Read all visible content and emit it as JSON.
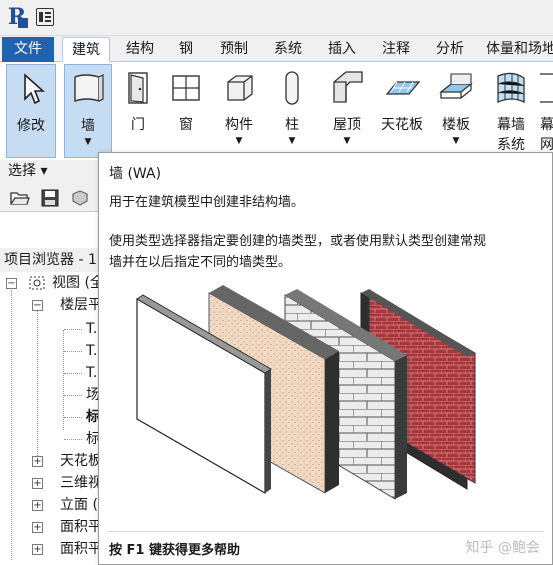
{
  "quick_access": {
    "logo_letter": "R",
    "menu_icon": "document-list-icon"
  },
  "tabs": [
    {
      "label": "文件"
    },
    {
      "label": "建筑"
    },
    {
      "label": "结构"
    },
    {
      "label": "钢"
    },
    {
      "label": "预制"
    },
    {
      "label": "系统"
    },
    {
      "label": "插入"
    },
    {
      "label": "注释"
    },
    {
      "label": "分析"
    },
    {
      "label": "体量和场地"
    }
  ],
  "ribbon": {
    "buttons": [
      {
        "label": "修改",
        "icon": "cursor-arrow-icon"
      },
      {
        "label": "墙",
        "icon": "wall-icon"
      },
      {
        "label": "门",
        "icon": "door-icon"
      },
      {
        "label": "窗",
        "icon": "window-icon"
      },
      {
        "label": "构件",
        "icon": "component-icon"
      },
      {
        "label": "柱",
        "icon": "column-icon"
      },
      {
        "label": "屋顶",
        "icon": "roof-icon"
      },
      {
        "label": "天花板",
        "icon": "ceiling-icon"
      },
      {
        "label": "楼板",
        "icon": "floor-icon"
      },
      {
        "label": "幕墙",
        "label2": "系统",
        "icon": "curtain-system-icon"
      },
      {
        "label": "幕",
        "label2": "网",
        "icon": "curtain-grid-icon"
      }
    ],
    "panel_label": "选择 ▾"
  },
  "browser": {
    "title": "项目浏览器 - 1",
    "rows": [
      {
        "label": "视图 (全"
      },
      {
        "label": "楼层平"
      },
      {
        "label": "T."
      },
      {
        "label": "T."
      },
      {
        "label": "T."
      },
      {
        "label": "场"
      },
      {
        "label": "标"
      },
      {
        "label": "标"
      },
      {
        "label": "天花板"
      },
      {
        "label": "三维视"
      },
      {
        "label": "立面 ("
      },
      {
        "label": "面积平"
      },
      {
        "label": "面积平"
      }
    ]
  },
  "tooltip": {
    "title": "墙 (WA)",
    "description": "用于在建筑模型中创建非结构墙。",
    "long_line1": "使用类型选择器指定要创建的墙类型，或者使用默认类型创建常规",
    "long_line2": "墙并在以后指定不同的墙类型。",
    "footer": "按 F1 键获得更多帮助",
    "watermark": "知乎 @鲍会"
  },
  "colors": {
    "file_tab": "#1f63b0",
    "selected_button": "#c5dcf2",
    "logo": "#1f4e9c",
    "brick": "#a8373b",
    "stucco": "#f2d9c4"
  }
}
